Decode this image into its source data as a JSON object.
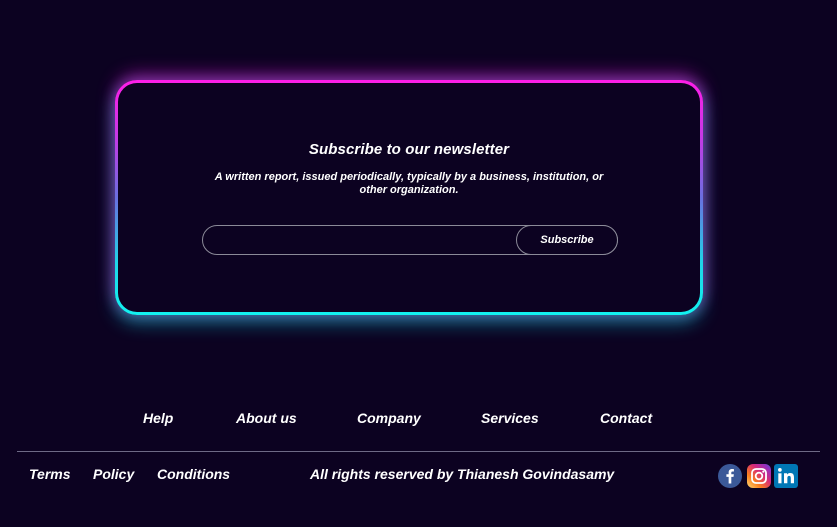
{
  "newsletter": {
    "title": "Subscribe to our newsletter",
    "description": "A written report, issued periodically, typically by a business, institution, or other organization.",
    "email_value": "",
    "email_placeholder": "",
    "subscribe_label": "Subscribe"
  },
  "footer": {
    "nav": [
      {
        "label": "Help"
      },
      {
        "label": "About us"
      },
      {
        "label": "Company"
      },
      {
        "label": "Services"
      },
      {
        "label": "Contact"
      }
    ],
    "legal": [
      {
        "label": "Terms"
      },
      {
        "label": "Policy"
      },
      {
        "label": "Conditions"
      }
    ],
    "copyright": "All rights reserved by Thianesh Govindasamy",
    "social": [
      {
        "icon": "facebook-icon",
        "color": "#3b5998"
      },
      {
        "icon": "instagram-icon",
        "color": "#e1306c"
      },
      {
        "icon": "linkedin-icon",
        "color": "#0077b5"
      }
    ]
  },
  "colors": {
    "background": "#0c0221",
    "neon_top": "#ff1ee8",
    "neon_bottom": "#12f2f0",
    "divider": "#6e6a86"
  }
}
